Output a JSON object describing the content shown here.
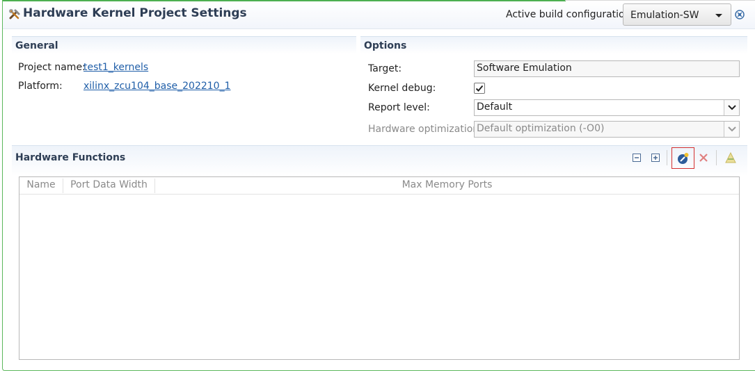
{
  "header": {
    "title": "Hardware Kernel Project Settings",
    "active_build_label": "Active build configuration:",
    "active_build_value": "Emulation-SW"
  },
  "general": {
    "heading": "General",
    "project_name_label": "Project name:",
    "project_name_value": "test1_kernels",
    "platform_label": "Platform:",
    "platform_value": "xilinx_zcu104_base_202210_1"
  },
  "options": {
    "heading": "Options",
    "target_label": "Target:",
    "target_value": "Software Emulation",
    "kernel_debug_label": "Kernel debug:",
    "kernel_debug_checked": true,
    "report_level_label": "Report level:",
    "report_level_value": "Default",
    "hw_opt_label": "Hardware optimization:",
    "hw_opt_value": "Default optimization (-O0)"
  },
  "hardware_functions": {
    "heading": "Hardware Functions",
    "columns": [
      "Name",
      "Port Data Width",
      "Max Memory Ports"
    ],
    "rows": []
  },
  "colors": {
    "accent_green": "#4caf50",
    "heading_text": "#2e3e55",
    "link": "#1f5ea8",
    "highlight_border": "#d32f2f"
  }
}
